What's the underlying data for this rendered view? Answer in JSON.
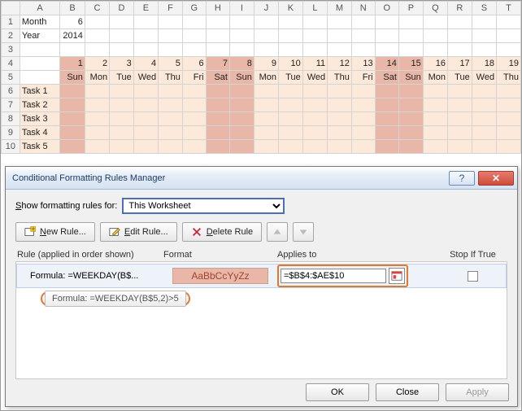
{
  "sheet": {
    "columns": [
      "A",
      "B",
      "C",
      "D",
      "E",
      "F",
      "G",
      "H",
      "I",
      "J",
      "K",
      "L",
      "M",
      "N",
      "O",
      "P",
      "Q",
      "R",
      "S",
      "T"
    ],
    "rowNums": [
      "1",
      "2",
      "3",
      "4",
      "5",
      "6",
      "7",
      "8",
      "9",
      "10"
    ],
    "a1": "Month",
    "b1": "6",
    "a2": "Year",
    "b2": "2014",
    "days": [
      "1",
      "2",
      "3",
      "4",
      "5",
      "6",
      "7",
      "8",
      "9",
      "10",
      "11",
      "12",
      "13",
      "14",
      "15",
      "16",
      "17",
      "18",
      "19"
    ],
    "wdays": [
      "Sun",
      "Mon",
      "Tue",
      "Wed",
      "Thu",
      "Fri",
      "Sat",
      "Sun",
      "Mon",
      "Tue",
      "Wed",
      "Thu",
      "Fri",
      "Sat",
      "Sun",
      "Mon",
      "Tue",
      "Wed",
      "Thu"
    ],
    "weekendIdx": [
      0,
      6,
      7,
      13,
      14
    ],
    "tasks": [
      "Task 1",
      "Task 2",
      "Task 3",
      "Task 4",
      "Task 5"
    ]
  },
  "dialog": {
    "title": "Conditional Formatting Rules Manager",
    "showFor": "Show formatting rules for:",
    "showForU": "S",
    "combo": "This Worksheet",
    "newRule": "New Rule...",
    "editRule": "Edit Rule...",
    "deleteRule": "Delete Rule",
    "hdrRule": "Rule (applied in order shown)",
    "hdrFormat": "Format",
    "hdrApplies": "Applies to",
    "hdrStop": "Stop If True",
    "ruleText": "Formula: =WEEKDAY(B$...",
    "preview": "AaBbCcYyZz",
    "appliesTo": "=$B$4:$AE$10",
    "tooltip": "Formula: =WEEKDAY(B$5,2)>5",
    "ok": "OK",
    "close": "Close",
    "apply": "Apply"
  }
}
